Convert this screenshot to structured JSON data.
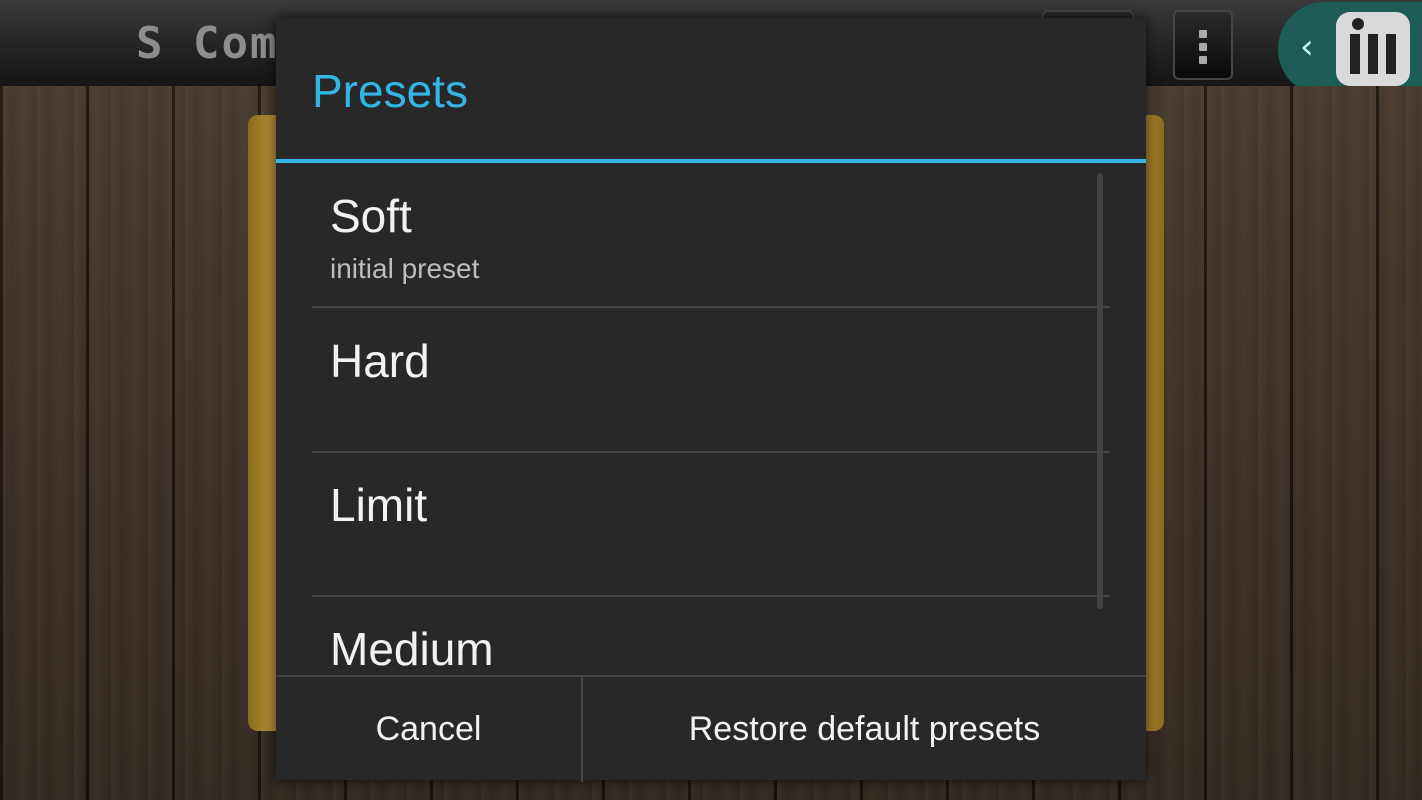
{
  "app": {
    "title": "S Com"
  },
  "dialog": {
    "title": "Presets",
    "accent_color": "#33b5e5",
    "items": [
      {
        "title": "Soft",
        "summary": "initial preset"
      },
      {
        "title": "Hard",
        "summary": ""
      },
      {
        "title": "Limit",
        "summary": ""
      },
      {
        "title": "Medium",
        "summary": ""
      }
    ],
    "buttons": {
      "cancel": "Cancel",
      "restore": "Restore default presets"
    }
  },
  "icons": {
    "overflow": "overflow-menu-icon",
    "back": "chevron-left-icon",
    "app": "piano-keys-icon"
  }
}
